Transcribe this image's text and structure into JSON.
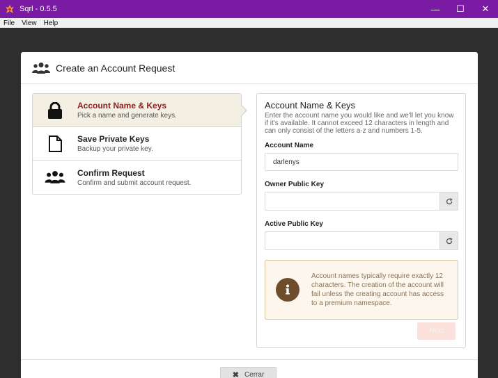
{
  "window": {
    "title": "Sqrl - 0.5.5",
    "minimize_glyph": "—",
    "maximize_glyph": "☐",
    "close_glyph": "✕"
  },
  "menu": {
    "items": [
      "File",
      "View",
      "Help"
    ]
  },
  "modal": {
    "title": "Create an Account Request",
    "title_icon": "users-icon"
  },
  "steps": [
    {
      "title": "Account Name & Keys",
      "description": "Pick a name and generate keys.",
      "icon": "lock-icon",
      "active": true
    },
    {
      "title": "Save Private Keys",
      "description": "Backup your private key.",
      "icon": "file-icon",
      "active": false
    },
    {
      "title": "Confirm Request",
      "description": "Confirm and submit account request.",
      "icon": "users-icon",
      "active": false
    }
  ],
  "form": {
    "title": "Account Name & Keys",
    "description": "Enter the account name you would like and we'll let you know if it's available. It cannot exceed 12 characters in length and can only consist of the letters a-z and numbers 1-5.",
    "account_name_label": "Account Name",
    "account_name_value": "darlenys",
    "owner_key_label": "Owner Public Key",
    "owner_key_value": "",
    "active_key_label": "Active Public Key",
    "active_key_value": "",
    "notice": "Account names typically require exactly 12 characters. The creation of the account will fail unless the creating account has access to a premium namespace.",
    "next_label": "Next"
  },
  "footer": {
    "close_label": "Cerrar",
    "close_glyph": "✖"
  },
  "colors": {
    "titlebar": "#7b1aa3",
    "active_step_title": "#8a1c1c",
    "notice_bg": "#fcf6ed",
    "next_disabled": "#fbe0dc"
  }
}
